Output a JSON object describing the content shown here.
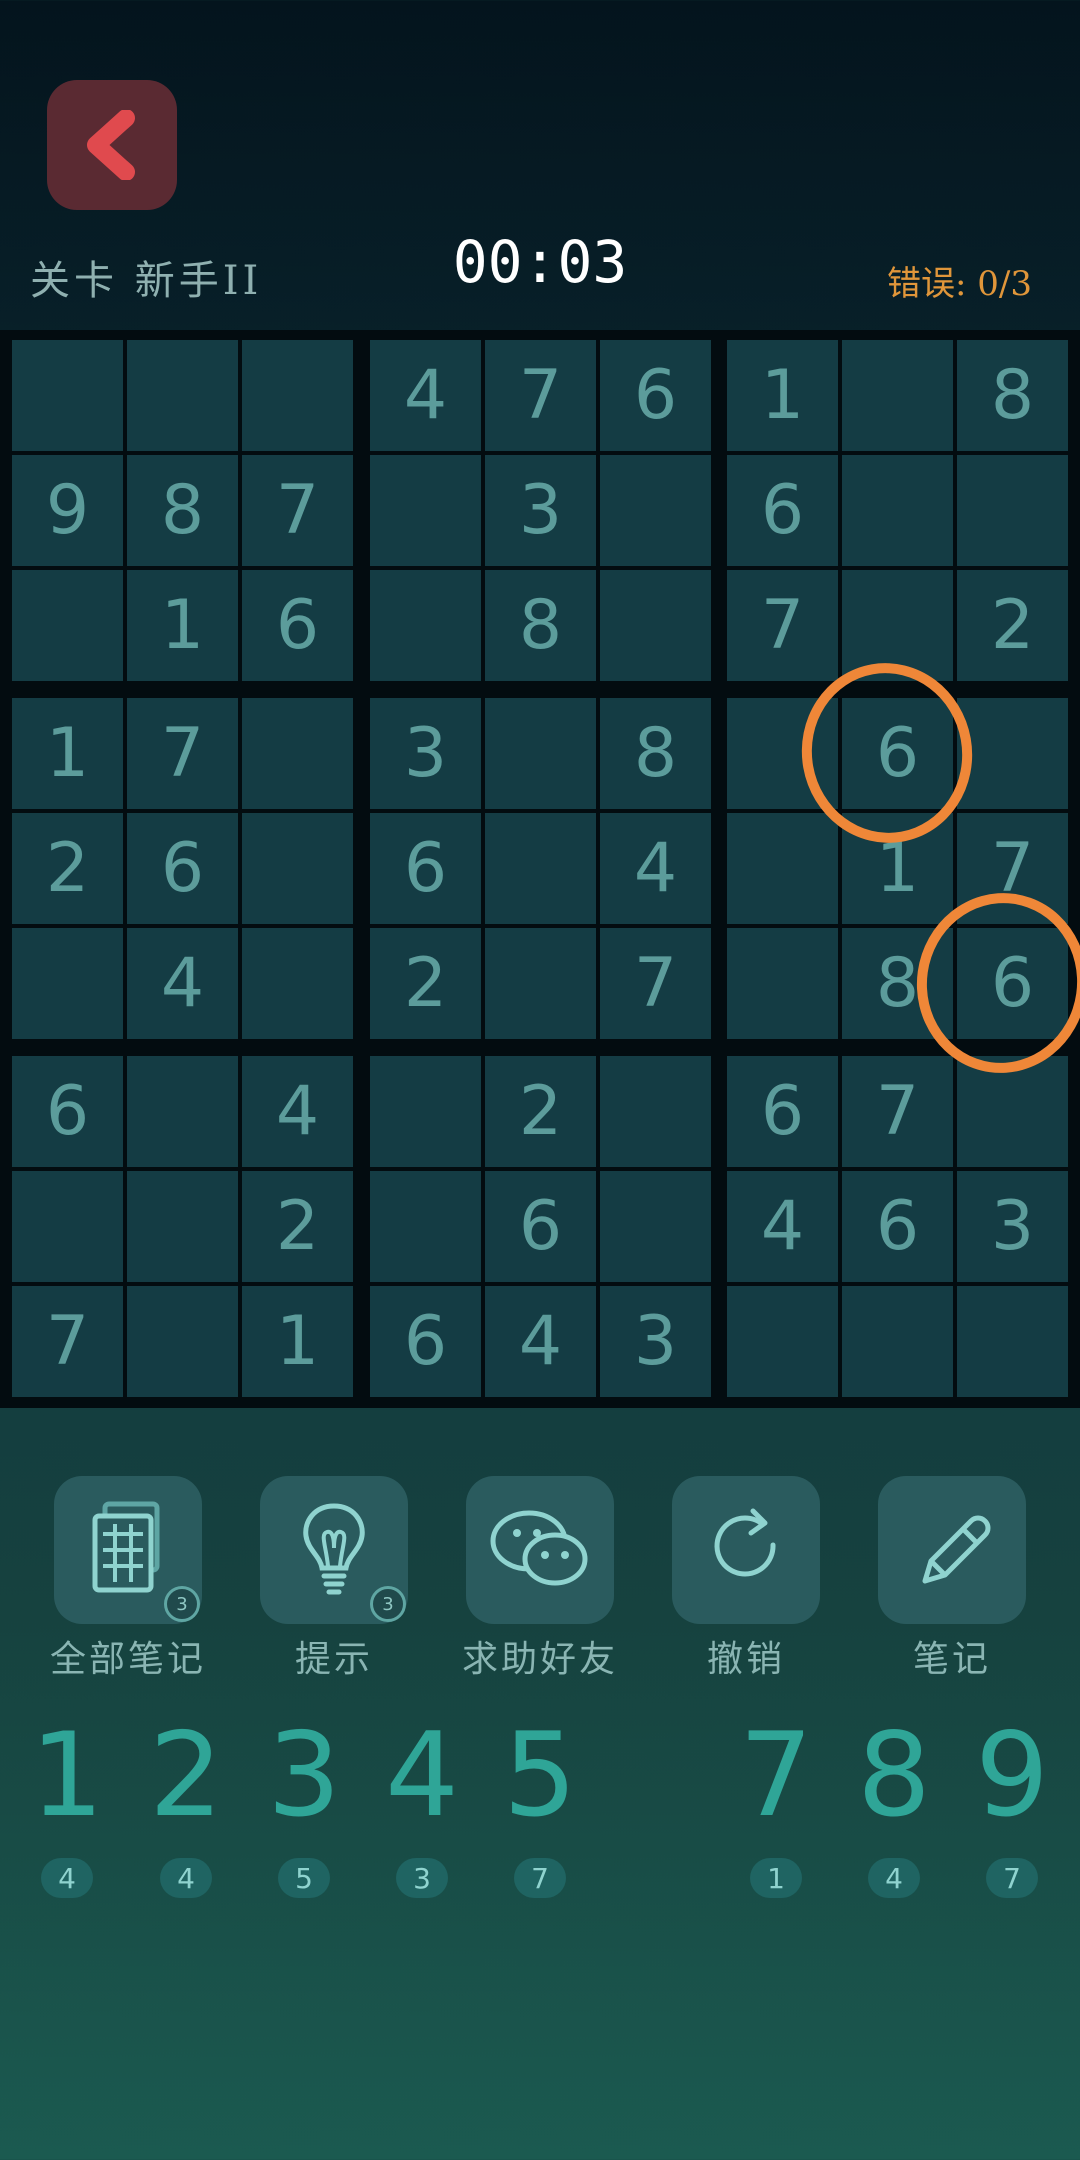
{
  "header": {
    "level": "关卡 新手II",
    "timer": "00:03",
    "errors": "错误: 0/3"
  },
  "board": [
    [
      "",
      "",
      "",
      "4",
      "7",
      "6",
      "1",
      "",
      "8"
    ],
    [
      "9",
      "8",
      "7",
      "",
      "3",
      "",
      "6",
      "",
      ""
    ],
    [
      "",
      "1",
      "6",
      "",
      "8",
      "",
      "7",
      "",
      "2"
    ],
    [
      "1",
      "7",
      "",
      "3",
      "",
      "8",
      "",
      "6",
      ""
    ],
    [
      "2",
      "6",
      "",
      "6",
      "",
      "4",
      "",
      "1",
      "7"
    ],
    [
      "",
      "4",
      "",
      "2",
      "",
      "7",
      "",
      "8",
      "6"
    ],
    [
      "6",
      "",
      "4",
      "",
      "2",
      "",
      "6",
      "7",
      ""
    ],
    [
      "",
      "",
      "2",
      "",
      "6",
      "",
      "4",
      "6",
      "3"
    ],
    [
      "7",
      "",
      "1",
      "6",
      "4",
      "3",
      "",
      "",
      ""
    ]
  ],
  "annotations": [
    {
      "row": 3,
      "col": 7,
      "color": "#ef8738"
    },
    {
      "row": 5,
      "col": 8,
      "color": "#ef8738"
    }
  ],
  "tools": [
    {
      "label": "全部笔记",
      "icon": "notes-grid-icon",
      "badge": "3"
    },
    {
      "label": "提示",
      "icon": "lightbulb-icon",
      "badge": "3"
    },
    {
      "label": "求助好友",
      "icon": "wechat-icon",
      "badge": ""
    },
    {
      "label": "撤销",
      "icon": "undo-icon",
      "badge": ""
    },
    {
      "label": "笔记",
      "icon": "pencil-icon",
      "badge": ""
    }
  ],
  "numpad": [
    {
      "digit": "1",
      "remaining": "4"
    },
    {
      "digit": "2",
      "remaining": "4"
    },
    {
      "digit": "3",
      "remaining": "5"
    },
    {
      "digit": "4",
      "remaining": "3"
    },
    {
      "digit": "5",
      "remaining": "7"
    },
    {
      "digit": "",
      "remaining": ""
    },
    {
      "digit": "7",
      "remaining": "1"
    },
    {
      "digit": "8",
      "remaining": "4"
    },
    {
      "digit": "9",
      "remaining": "7"
    }
  ],
  "colors": {
    "accent": "#2fa597",
    "error": "#e0963a",
    "back_button": "#5a2a32",
    "cell": "#143c44"
  }
}
